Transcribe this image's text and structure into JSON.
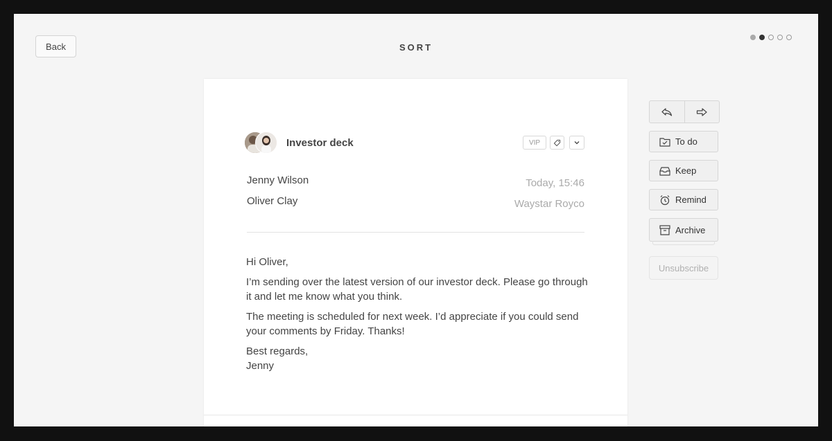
{
  "header": {
    "back_label": "Back",
    "title": "SORT",
    "progress_dots": 5,
    "current_step": 2
  },
  "email": {
    "subject": "Investor deck",
    "badge_vip": "VIP",
    "from": "Jenny Wilson",
    "to": "Oliver Clay",
    "time": "Today, 15:46",
    "company": "Waystar Royco",
    "body": {
      "greeting": "Hi Oliver,",
      "paragraph1": "I’m sending over the latest version of our investor deck. Please go through it and let me know what you think.",
      "paragraph2": "The meeting is scheduled for next week. I’d appreciate if you could send your comments by Friday. Thanks!",
      "signoff": "Best regards,",
      "signature": "Jenny"
    }
  },
  "actions": {
    "todo": "To do",
    "keep": "Keep",
    "remind": "Remind",
    "archive": "Archive",
    "unsubscribe": "Unsubscribe"
  },
  "icons": {
    "reply": "reply-icon",
    "forward": "forward-icon",
    "todo": "folder-check-icon",
    "keep": "inbox-icon",
    "remind": "alarm-clock-icon",
    "archive": "archive-box-icon",
    "tag": "tag-icon",
    "more": "chevron-down-icon"
  }
}
